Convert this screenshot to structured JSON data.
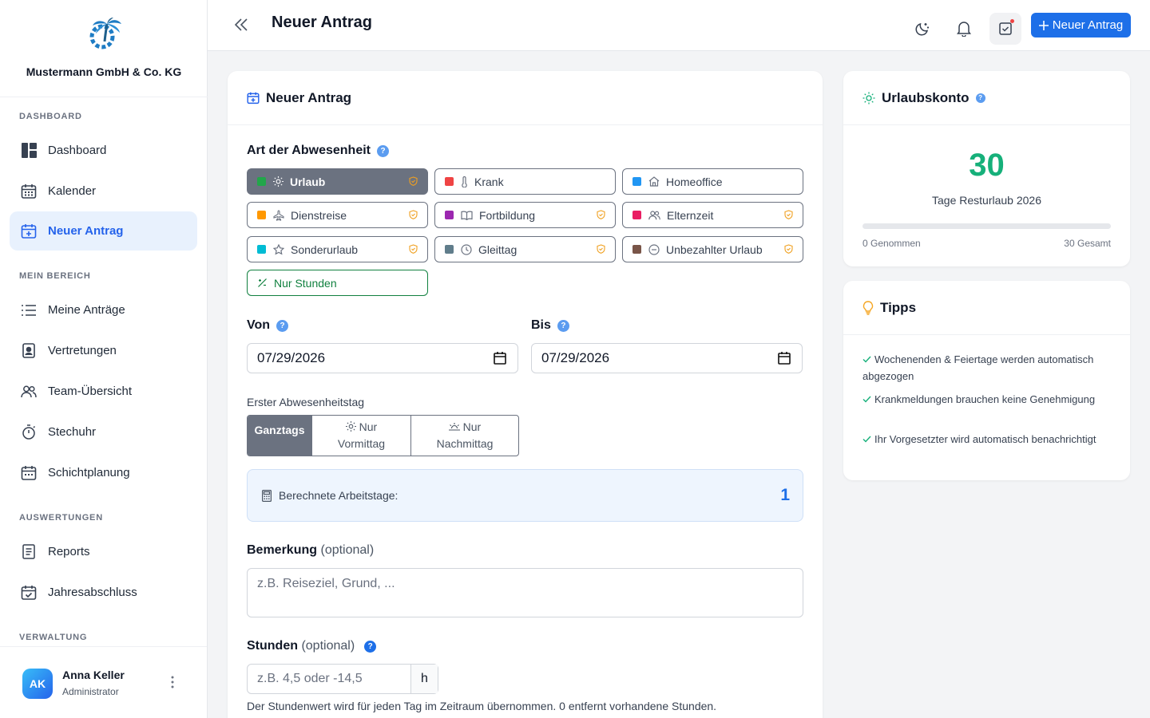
{
  "company": "Mustermann GmbH & Co. KG",
  "sidebar": {
    "sections": [
      {
        "title": "DASHBOARD"
      },
      {
        "title": "MEIN BEREICH"
      },
      {
        "title": "AUSWERTUNGEN"
      },
      {
        "title": "VERWALTUNG"
      }
    ],
    "items": [
      {
        "label": "Dashboard",
        "icon": "dashboard-icon"
      },
      {
        "label": "Kalender",
        "icon": "calendar-icon"
      },
      {
        "label": "Neuer Antrag",
        "icon": "calendar-plus-icon",
        "active": true
      },
      {
        "label": "Meine Anträge",
        "icon": "list-icon"
      },
      {
        "label": "Vertretungen",
        "icon": "badge-icon"
      },
      {
        "label": "Team-Übersicht",
        "icon": "users-icon"
      },
      {
        "label": "Stechuhr",
        "icon": "stopwatch-icon"
      },
      {
        "label": "Schichtplanung",
        "icon": "calendar-grid-icon"
      },
      {
        "label": "Reports",
        "icon": "document-icon"
      },
      {
        "label": "Jahresabschluss",
        "icon": "calendar-check-icon"
      }
    ],
    "user": {
      "initials": "AK",
      "name": "Anna Keller",
      "role": "Administrator"
    }
  },
  "header": {
    "title": "Neuer Antrag",
    "new_button": "Neuer Antrag"
  },
  "form": {
    "card_title": "Neuer Antrag",
    "type_label": "Art der Abwesenheit",
    "types": [
      {
        "label": "Urlaub",
        "color": "#22a64a",
        "icon": "sun-icon",
        "selected": true,
        "approval": true
      },
      {
        "label": "Krank",
        "color": "#ef4444",
        "icon": "thermometer-icon",
        "approval": false
      },
      {
        "label": "Homeoffice",
        "color": "#2196f3",
        "icon": "home-icon",
        "approval": false
      },
      {
        "label": "Dienstreise",
        "color": "#ff9800",
        "icon": "plane-icon",
        "approval": true
      },
      {
        "label": "Fortbildung",
        "color": "#9c27b0",
        "icon": "book-icon",
        "approval": true
      },
      {
        "label": "Elternzeit",
        "color": "#e91e63",
        "icon": "users-icon",
        "approval": true
      },
      {
        "label": "Sonderurlaub",
        "color": "#00bcd4",
        "icon": "star-icon",
        "approval": true
      },
      {
        "label": "Gleittag",
        "color": "#607d8b",
        "icon": "clock-icon",
        "approval": true
      },
      {
        "label": "Unbezahlter Urlaub",
        "color": "#795548",
        "icon": "minus-circle-icon",
        "approval": true
      },
      {
        "label": "Nur Stunden",
        "color": "#10803f",
        "icon": "percent-icon",
        "approval": false
      }
    ],
    "from_label": "Von",
    "from_value": "07/29/2026",
    "to_label": "Bis",
    "to_value": "07/29/2026",
    "first_day_label": "Erster Abwesenheitstag",
    "first_day_options": [
      {
        "label": "Ganztags",
        "selected": true
      },
      {
        "label": "Nur Vormittag",
        "line1": "Nur",
        "line2": "Vormittag",
        "icon": "sun-icon"
      },
      {
        "label": "Nur Nachmittag",
        "line1": "Nur",
        "line2": "Nachmittag",
        "icon": "sunset-icon"
      }
    ],
    "calc_label": "Berechnete Arbeitstage:",
    "calc_value": "1",
    "remark_label": "Bemerkung",
    "remark_optional": "(optional)",
    "remark_placeholder": "z.B. Reiseziel, Grund, ...",
    "hours_label": "Stunden",
    "hours_optional": "(optional)",
    "hours_placeholder": "z.B. 4,5 oder -14,5",
    "hours_unit": "h",
    "hours_hint": "Der Stundenwert wird für jeden Tag im Zeitraum übernommen. 0 entfernt vorhandene Stunden."
  },
  "vacation": {
    "title": "Urlaubskonto",
    "remaining": "30",
    "remaining_label": "Tage Resturlaub 2026",
    "taken": "0 Genommen",
    "total": "30 Gesamt",
    "taken_fraction": 0
  },
  "tips": {
    "title": "Tipps",
    "items": [
      "Wochenenden & Feiertage werden automatisch abgezogen",
      "Krankmeldungen brauchen keine Genehmigung",
      "Ihr Vorgesetzter wird automatisch benachrichtigt"
    ]
  }
}
